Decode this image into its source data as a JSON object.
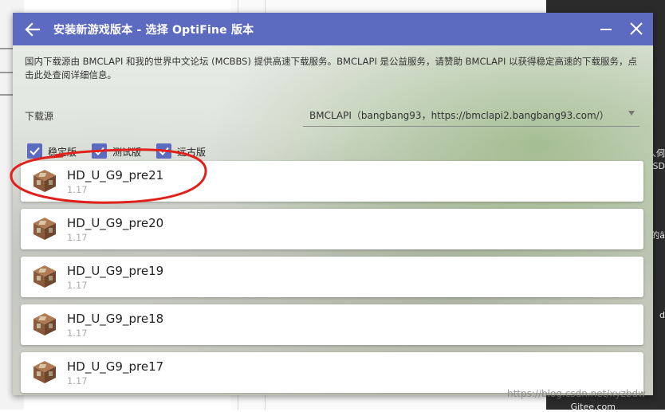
{
  "dialog": {
    "title": "安装新游戏版本 - 选择 OptiFine 版本",
    "back_icon": "arrow-left-icon",
    "minimize_icon": "minimize-icon",
    "close_icon": "close-icon",
    "accent_color": "#5c6bc0"
  },
  "info_text": "国内下载源由 BMCLAPI 和我的世界中文论坛 (MCBBS) 提供高速下载服务。BMCLAPI 是公益服务，请赞助 BMCLAPI 以获得稳定高速的下载服务，点击此处查阅详细信息。",
  "download_source": {
    "label": "下载源",
    "value": "BMCLAPI（bangbang93，https://bmclapi2.bangbang93.com/）"
  },
  "filters": [
    {
      "label": "稳定版",
      "checked": true
    },
    {
      "label": "测试版",
      "checked": true
    },
    {
      "label": "远古版",
      "checked": true
    }
  ],
  "versions": [
    {
      "name": "HD_U_G9_pre21",
      "game_version": "1.17"
    },
    {
      "name": "HD_U_G9_pre20",
      "game_version": "1.17"
    },
    {
      "name": "HD_U_G9_pre19",
      "game_version": "1.17"
    },
    {
      "name": "HD_U_G9_pre18",
      "game_version": "1.17"
    },
    {
      "name": "HD_U_G9_pre17",
      "game_version": "1.17"
    }
  ],
  "background_fragments": [
    "人伺",
    "SD",
    "的ȃ",
    "d",
    "Gitee.com"
  ],
  "watermark": "https://blog.csdn.net/xyzbdw",
  "annotation_color": "#e0201a"
}
